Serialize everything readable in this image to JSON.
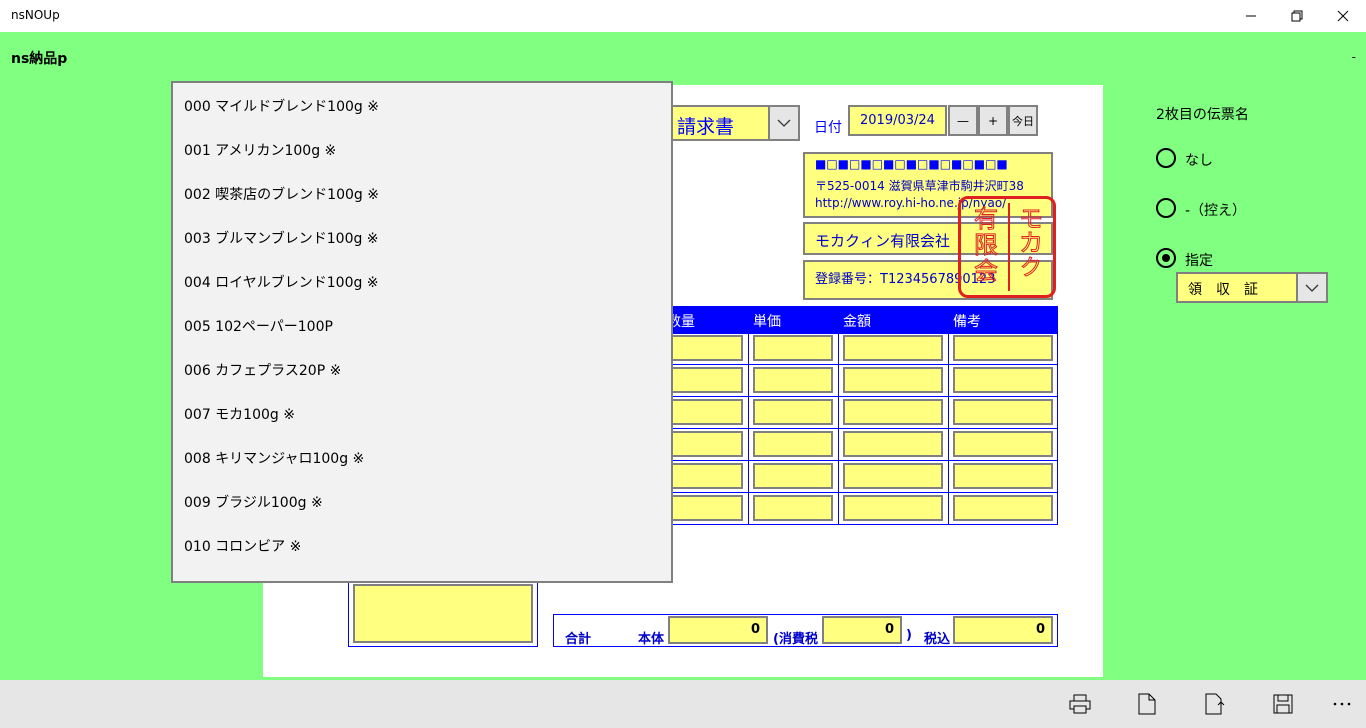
{
  "window": {
    "title": "nsNOUp"
  },
  "app": {
    "header": "ns納品p",
    "overflow_mark": "-"
  },
  "document": {
    "type_selected": "請求書",
    "date_label": "日付",
    "date_value": "2019/03/24",
    "minus_label": "—",
    "plus_label": "+",
    "today_label": "今日"
  },
  "company": {
    "name_encoded": "■□■□■□■□■□■□■□■□■",
    "address": "〒525-0014 滋賀県草津市駒井沢町38",
    "url": "http://www.roy.hi-ho.ne.jp/nyao/",
    "name": "モカクィン有限会社",
    "registration": "登録番号：T1234567890123",
    "seal_text": "モカクィン有限会社"
  },
  "table": {
    "headers": [
      "数量",
      "単価",
      "金額",
      "備考"
    ]
  },
  "totals": {
    "label_total": "合計",
    "label_body": "本体",
    "body_value": "0",
    "label_tax": "(消費税",
    "tax_value": "0",
    "close_paren": ")",
    "label_taxin": "税込",
    "taxin_value": "0"
  },
  "product_list": [
    "000 マイルドブレンド100g ※",
    "001 アメリカン100g ※",
    "002 喫茶店のブレンド100g ※",
    "003 ブルマンブレンド100g ※",
    "004 ロイヤルブレンド100g ※",
    "005 102ペーパー100P",
    "006 カフェプラス20P ※",
    "007 モカ100g ※",
    "008 キリマンジャロ100g ※",
    "009 ブラジル100g ※",
    "010 コロンビア ※"
  ],
  "second_slip": {
    "heading": "2枚目の伝票名",
    "options": [
      "なし",
      "-（控え）",
      "指定"
    ],
    "selected_index": 2,
    "custom_value": "領　収　証"
  },
  "icons": [
    "print-icon",
    "new-document-icon",
    "export-icon",
    "save-icon",
    "more-icon"
  ]
}
